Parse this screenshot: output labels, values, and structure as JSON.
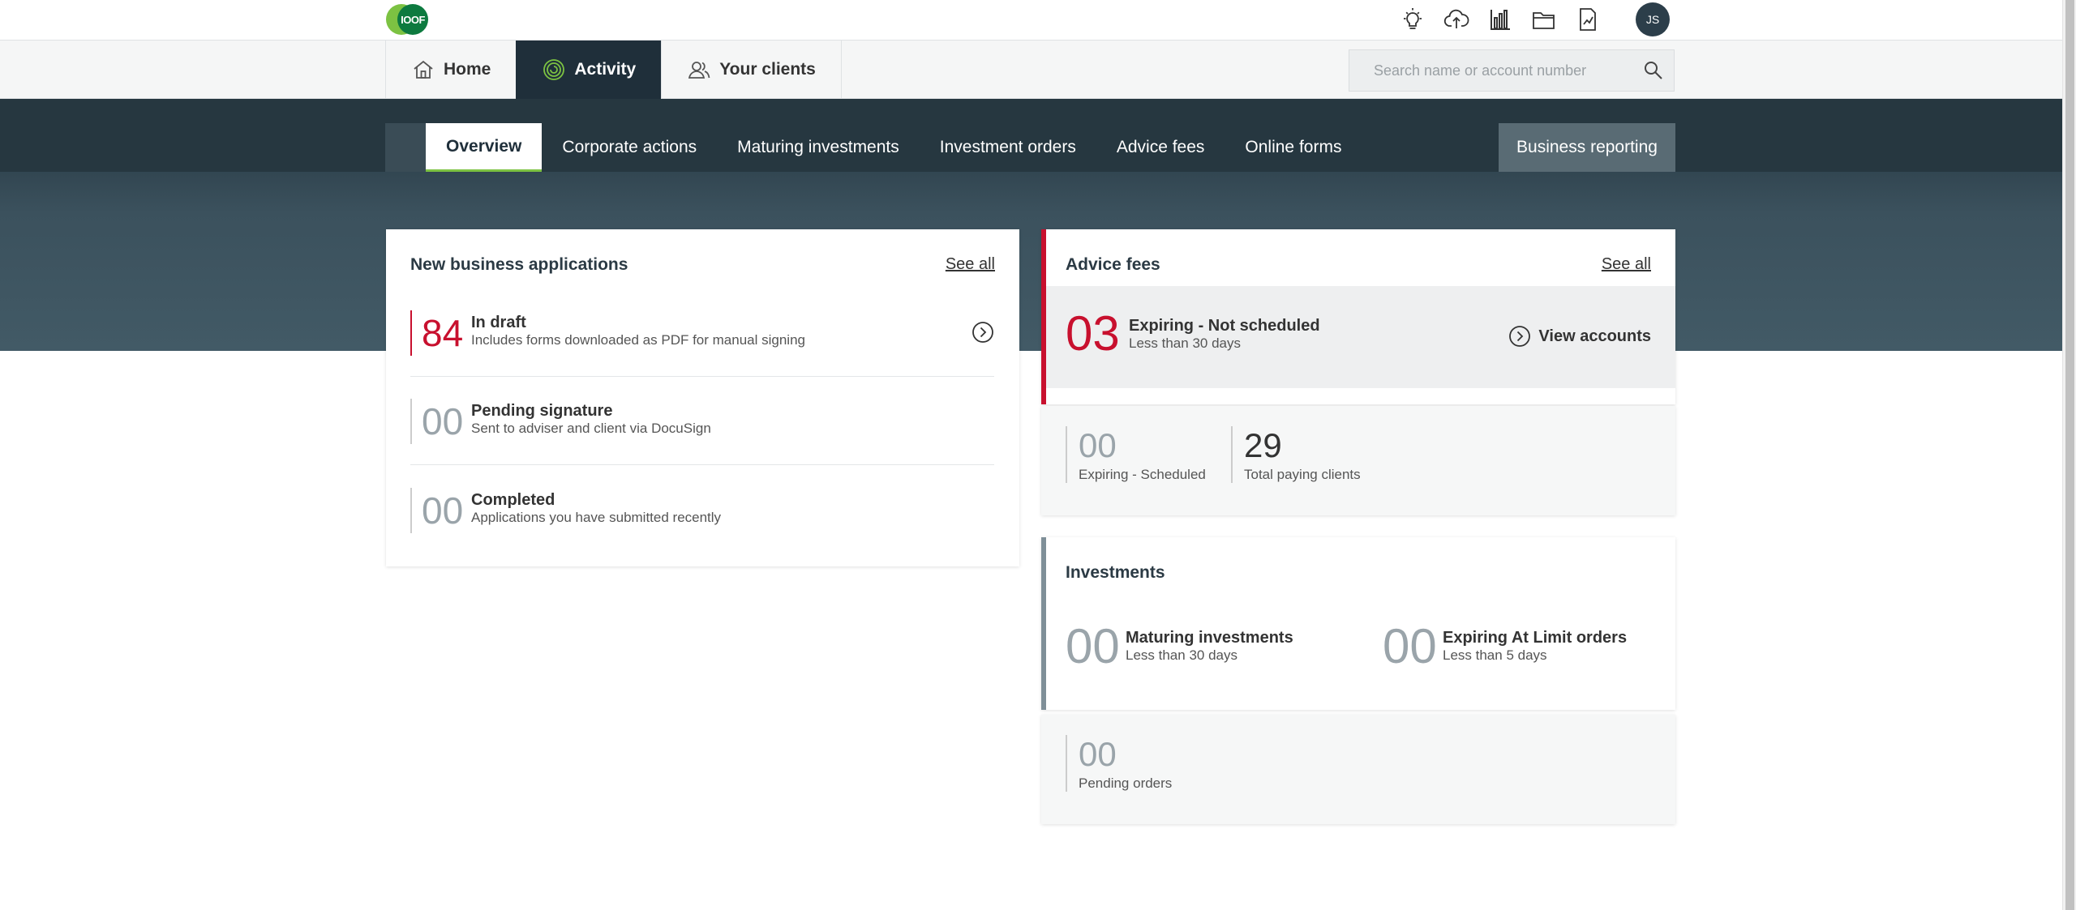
{
  "brand": {
    "logo_text": "IOOF"
  },
  "topbar": {
    "icons": [
      "lightbulb-icon",
      "cloud-upload-icon",
      "bar-chart-icon",
      "folder-icon",
      "document-chart-icon"
    ],
    "avatar_initials": "JS"
  },
  "main_nav": {
    "tabs": [
      {
        "label": "Home",
        "icon": "home-icon"
      },
      {
        "label": "Activity",
        "icon": "activity-icon",
        "active": true
      },
      {
        "label": "Your clients",
        "icon": "users-icon"
      }
    ],
    "search": {
      "placeholder": "Search name or account number",
      "value": ""
    }
  },
  "sub_nav": {
    "tabs": [
      {
        "label": "Overview",
        "active": true
      },
      {
        "label": "Corporate actions"
      },
      {
        "label": "Maturing investments"
      },
      {
        "label": "Investment orders"
      },
      {
        "label": "Advice fees"
      },
      {
        "label": "Online forms"
      }
    ],
    "business_reporting": "Business reporting"
  },
  "new_business": {
    "title": "New business applications",
    "see_all": "See all",
    "rows": [
      {
        "count": "84",
        "label": "In draft",
        "sub": "Includes forms downloaded as PDF for manual signing"
      },
      {
        "count": "00",
        "label": "Pending signature",
        "sub": "Sent to adviser and client via DocuSign"
      },
      {
        "count": "00",
        "label": "Completed",
        "sub": "Applications you have submitted recently"
      }
    ]
  },
  "advice_fees": {
    "title": "Advice fees",
    "see_all": "See all",
    "highlight": {
      "count": "03",
      "label": "Expiring - Not scheduled",
      "sub": "Less than 30 days",
      "action": "View accounts"
    },
    "stats": [
      {
        "count": "00",
        "label": "Expiring - Scheduled"
      },
      {
        "count": "29",
        "label": "Total paying clients"
      }
    ]
  },
  "investments": {
    "title": "Investments",
    "items": [
      {
        "count": "00",
        "label": "Maturing investments",
        "sub": "Less than 30 days"
      },
      {
        "count": "00",
        "label": "Expiring At Limit orders",
        "sub": "Less than 5 days"
      }
    ],
    "pending": {
      "count": "00",
      "label": "Pending orders"
    }
  },
  "colors": {
    "accent_red": "#c8102e",
    "nav_dark": "#1f2f3a",
    "brand_green": "#7cc242"
  }
}
